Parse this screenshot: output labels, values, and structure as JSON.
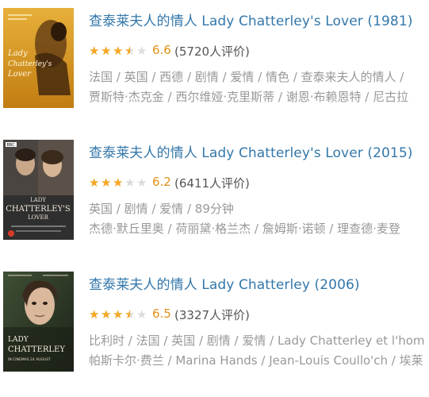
{
  "results": [
    {
      "title": "查泰莱夫人的情人 Lady Chatterley's Lover (1981)",
      "stars_fraction": 0.7,
      "score": "6.6",
      "votes": "(5720人评价)",
      "meta_line1": "法国 / 英国 / 西德 / 剧情 / 爱情 / 情色 / 查泰来夫人的情人 /",
      "meta_line2": "贾斯特·杰克金 / 西尔维娅·克里斯蒂 / 谢恩·布赖恩特 / 尼古拉",
      "poster_text": "Lady Chatterley's Lover",
      "poster_bg": "#d89a1e"
    },
    {
      "title": "查泰莱夫人的情人 Lady Chatterley's Lover (2015)",
      "stars_fraction": 0.6,
      "score": "6.2",
      "votes": "(6411人评价)",
      "meta_line1": "英国 / 剧情 / 爱情 / 89分钟",
      "meta_line2": "杰德·默丘里奥 / 荷丽黛·格兰杰 / 詹姆斯·诺顿 / 理查德·麦登",
      "poster_text": "LADY CHATTERLEY'S LOVER",
      "poster_badge": "BBC",
      "poster_bg": "#3a3a3a"
    },
    {
      "title": "查泰莱夫人的情人 Lady Chatterley (2006)",
      "stars_fraction": 0.7,
      "score": "6.5",
      "votes": "(3327人评价)",
      "meta_line1": "比利时 / 法国 / 英国 / 剧情 / 爱情 / Lady Chatterley et l'hom",
      "meta_line2": "帕斯卡尔·费兰 / Marina Hands / Jean-Louis Coullo'ch / 埃莱",
      "poster_text": "LADY CHATTERLEY",
      "poster_subtext": "IN CINEMAS 24 AUGUST",
      "poster_bg": "#2e3a2a"
    }
  ],
  "colors": {
    "title": "#3377aa",
    "star_on": "#f5a623",
    "star_off": "#dcdcdc",
    "score": "#e09015"
  }
}
